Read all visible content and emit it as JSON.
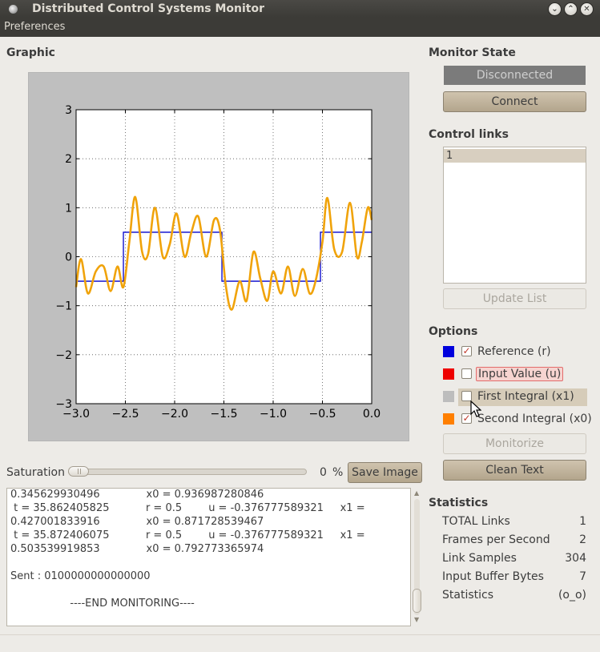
{
  "window": {
    "title": "Distributed Control Systems Monitor",
    "buttons": [
      "minimize",
      "maximize",
      "close"
    ]
  },
  "menubar": {
    "items": [
      "Preferences"
    ]
  },
  "graphic": {
    "title": "Graphic",
    "chart_data": {
      "type": "line",
      "xlim": [
        -3.0,
        0.0
      ],
      "ylim": [
        -3,
        3
      ],
      "x_ticks": [
        "−3.0",
        "−2.5",
        "−2.0",
        "−1.5",
        "−1.0",
        "−0.5",
        "0.0"
      ],
      "y_ticks": [
        "3",
        "2",
        "1",
        "0",
        "−1",
        "−2",
        "−3"
      ],
      "grid": true,
      "series": [
        {
          "color": "#0000cc",
          "step_points": [
            [
              -3.0,
              -0.5
            ],
            [
              -2.52,
              -0.5
            ],
            [
              -2.52,
              0.5
            ],
            [
              -1.52,
              0.5
            ],
            [
              -1.52,
              -0.5
            ],
            [
              -0.52,
              -0.5
            ],
            [
              -0.52,
              0.5
            ],
            [
              0.0,
              0.5
            ]
          ]
        },
        {
          "color": "#f0a30a",
          "points": [
            [
              -3.0,
              -0.62
            ],
            [
              -2.95,
              -0.05
            ],
            [
              -2.88,
              -0.75
            ],
            [
              -2.8,
              -0.3
            ],
            [
              -2.72,
              -0.2
            ],
            [
              -2.65,
              -0.7
            ],
            [
              -2.58,
              -0.2
            ],
            [
              -2.52,
              -0.62
            ],
            [
              -2.46,
              0.3
            ],
            [
              -2.4,
              1.22
            ],
            [
              -2.33,
              0.1
            ],
            [
              -2.27,
              0.05
            ],
            [
              -2.2,
              1.0
            ],
            [
              -2.12,
              0.0
            ],
            [
              -2.05,
              0.25
            ],
            [
              -1.98,
              0.88
            ],
            [
              -1.9,
              0.0
            ],
            [
              -1.83,
              0.5
            ],
            [
              -1.76,
              0.82
            ],
            [
              -1.68,
              0.0
            ],
            [
              -1.6,
              0.75
            ],
            [
              -1.54,
              0.55
            ],
            [
              -1.48,
              -0.6
            ],
            [
              -1.42,
              -1.08
            ],
            [
              -1.34,
              -0.5
            ],
            [
              -1.27,
              -0.9
            ],
            [
              -1.2,
              0.1
            ],
            [
              -1.13,
              -0.45
            ],
            [
              -1.06,
              -0.9
            ],
            [
              -1.0,
              -0.3
            ],
            [
              -0.92,
              -0.75
            ],
            [
              -0.85,
              -0.2
            ],
            [
              -0.78,
              -0.8
            ],
            [
              -0.7,
              -0.25
            ],
            [
              -0.63,
              -0.75
            ],
            [
              -0.57,
              -0.5
            ],
            [
              -0.5,
              0.3
            ],
            [
              -0.45,
              1.2
            ],
            [
              -0.38,
              0.15
            ],
            [
              -0.3,
              0.1
            ],
            [
              -0.22,
              1.1
            ],
            [
              -0.15,
              0.0
            ],
            [
              -0.1,
              0.3
            ],
            [
              -0.04,
              1.0
            ],
            [
              0.0,
              0.75
            ]
          ]
        }
      ]
    }
  },
  "monitor_state": {
    "title": "Monitor State",
    "status": "Disconnected",
    "connect_button": "Connect"
  },
  "control_links": {
    "title": "Control links",
    "items": [
      "1"
    ],
    "update_button": "Update List"
  },
  "options": {
    "title": "Options",
    "items": [
      {
        "label": "Reference (r)",
        "color": "#0000dd",
        "checked": true
      },
      {
        "label": "Input Value (u)",
        "color": "#ee0000",
        "checked": false
      },
      {
        "label": "First Integral (x1)",
        "color": "#bdbdbd",
        "checked": false
      },
      {
        "label": "Second Integral (x0)",
        "color": "#ff7f00",
        "checked": true
      }
    ],
    "monitorize_button": "Monitorize",
    "clean_button": "Clean Text"
  },
  "saturation": {
    "label": "Saturation",
    "value": "0",
    "unit": "%",
    "save_button": "Save Image"
  },
  "log": {
    "lines": [
      "0.345629930496              x0 = 0.936987280846",
      " t = 35.862405825           r = 0.5        u = -0.376777589321     x1 =",
      "0.427001833916              x0 = 0.871728539467",
      " t = 35.872406075           r = 0.5        u = -0.376777589321     x1 =",
      "0.503539919853              x0 = 0.792773365974",
      "",
      "Sent : 0100000000000000",
      "",
      "                  ----END MONITORING----"
    ]
  },
  "statistics": {
    "title": "Statistics",
    "rows": [
      {
        "label": "TOTAL Links",
        "value": "1"
      },
      {
        "label": "Frames per Second",
        "value": "2"
      },
      {
        "label": "Link Samples",
        "value": "304"
      },
      {
        "label": "Input Buffer Bytes",
        "value": "7"
      },
      {
        "label": "Statistics",
        "value": "(o_o)"
      }
    ]
  }
}
